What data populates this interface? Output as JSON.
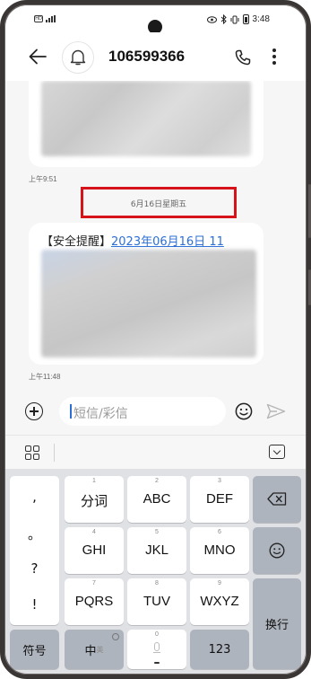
{
  "status_bar": {
    "sim_label": "HD",
    "time": "3:48"
  },
  "header": {
    "title": "106599366"
  },
  "conversation": {
    "first_message_time": "上午9:51",
    "date_separator": "6月16日星期五",
    "second_message": {
      "tag": "【安全提醒】",
      "link_text": "2023年06月16日 11",
      "time": "上午11:48"
    }
  },
  "compose": {
    "placeholder": "短信/彩信"
  },
  "keyboard": {
    "punctuation": [
      ",",
      "。",
      "?",
      "!"
    ],
    "keys_row1": [
      {
        "sub": "1",
        "label": "分词"
      },
      {
        "sub": "2",
        "label": "ABC"
      },
      {
        "sub": "3",
        "label": "DEF"
      }
    ],
    "keys_row2": [
      {
        "sub": "4",
        "label": "GHI"
      },
      {
        "sub": "5",
        "label": "JKL"
      },
      {
        "sub": "6",
        "label": "MNO"
      }
    ],
    "keys_row3": [
      {
        "sub": "7",
        "label": "PQRS"
      },
      {
        "sub": "8",
        "label": "TUV"
      },
      {
        "sub": "9",
        "label": "WXYZ"
      }
    ],
    "enter_label": "换行",
    "symbol_label": "符号",
    "lang_label": "中",
    "lang_sub": "英",
    "space_sub": "0",
    "num_label": "123"
  }
}
